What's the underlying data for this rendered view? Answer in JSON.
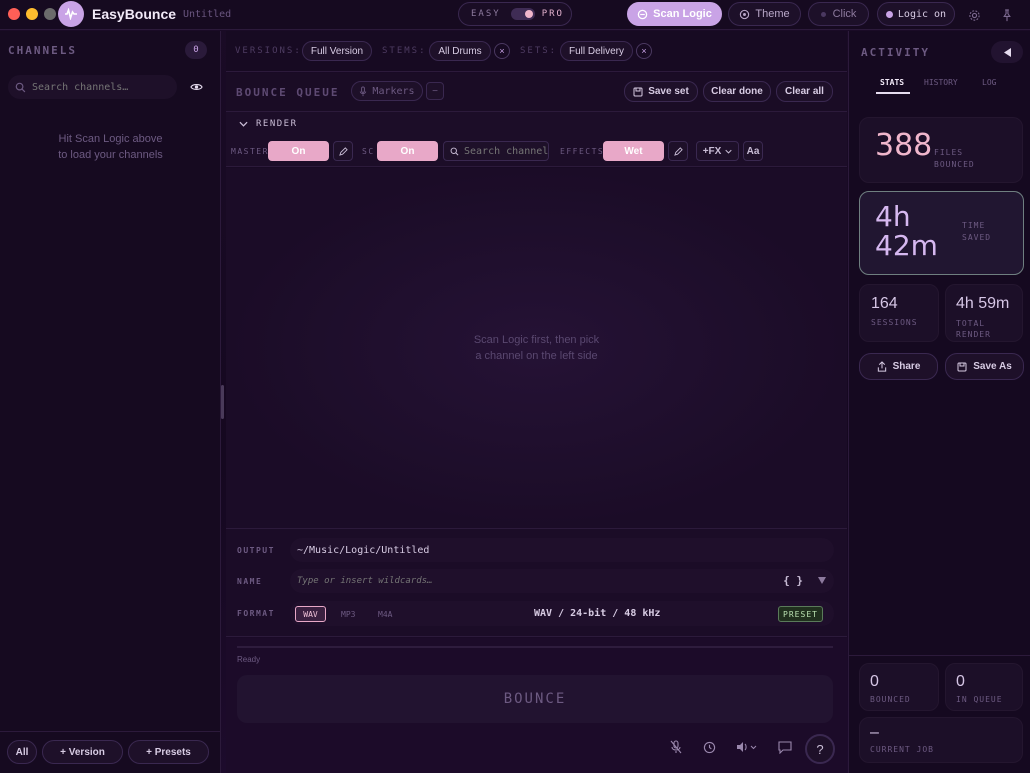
{
  "window": {
    "app_name": "EasyBounce",
    "project": "Untitled"
  },
  "topbar": {
    "mode_easy": "EASY",
    "mode_pro": "PRO",
    "scan_label": "Scan Logic",
    "theme_label": "Theme",
    "click_label": "Click",
    "logic_status": "Logic on"
  },
  "channels": {
    "title": "CHANNELS",
    "count": "0",
    "search_placeholder": "Search channels…",
    "empty_line1": "Hit Scan Logic above",
    "empty_line2": "to load your channels",
    "footer": {
      "all": "All",
      "version": "+ Version",
      "presets": "+ Presets"
    }
  },
  "filters": {
    "versions_label": "VERSIONS:",
    "versions_value": "Full Version",
    "stems_label": "STEMS:",
    "stems_value": "All Drums",
    "sets_label": "SETS:",
    "sets_value": "Full Delivery",
    "remove_glyph": "×"
  },
  "queue": {
    "title": "BOUNCE QUEUE",
    "markers_label": "Markers",
    "minus": "−",
    "save_set": "Save set",
    "clear_done": "Clear done",
    "clear_all": "Clear all"
  },
  "render": {
    "section_title": "RENDER",
    "master_label": "MASTER",
    "master_value": "On",
    "sc_label": "SC",
    "sc_value": "On",
    "search_placeholder": "Search channel…",
    "effects_label": "EFFECTS",
    "effects_value": "Wet",
    "fx_label": "+FX",
    "aa_label": "Aa",
    "empty_line1": "Scan Logic first, then pick",
    "empty_line2": "a channel on the left side"
  },
  "output": {
    "output_label": "OUTPUT",
    "output_path": "~/Music/Logic/Untitled",
    "name_label": "NAME",
    "name_placeholder": "Type or insert wildcards…",
    "wildcards": "{ }",
    "format_label": "FORMAT",
    "formats": [
      "WAV",
      "MP3",
      "M4A"
    ],
    "format_summary": "WAV / 24-bit / 48 kHz",
    "preset_label": "PRESET"
  },
  "status": {
    "ready": "Ready",
    "bounce": "BOUNCE"
  },
  "activity": {
    "title": "ACTIVITY",
    "tabs": [
      "STATS",
      "HISTORY",
      "LOG"
    ],
    "files_bounced_value": "388",
    "files_bounced_label1": "FILES",
    "files_bounced_label2": "BOUNCED",
    "time_saved_value1": "4h",
    "time_saved_value2": "42m",
    "time_saved_label1": "TIME",
    "time_saved_label2": "SAVED",
    "sessions_value": "164",
    "sessions_label": "SESSIONS",
    "total_render_value": "4h 59m",
    "total_render_label1": "TOTAL",
    "total_render_label2": "RENDER",
    "share": "Share",
    "save_as": "Save As",
    "bounced_value": "0",
    "bounced_label": "BOUNCED",
    "in_queue_value": "0",
    "in_queue_label": "IN QUEUE",
    "current_job_value": "–",
    "current_job_label": "CURRENT JOB"
  },
  "bottom_toolbar": {
    "help": "?"
  },
  "colors": {
    "accent_pink": "#e8a8c8",
    "scan_purple": "#c9a3e6",
    "background": "#15091f"
  }
}
